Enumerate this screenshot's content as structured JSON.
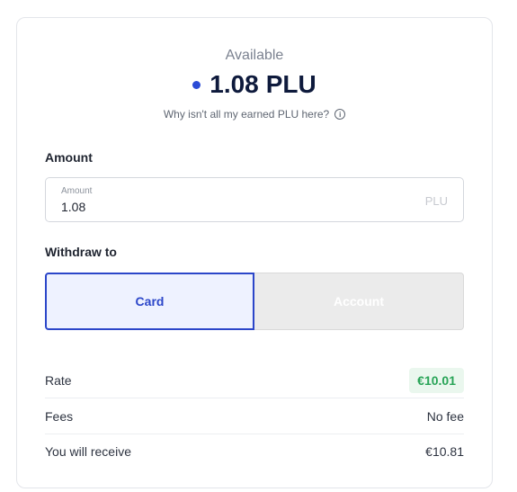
{
  "header": {
    "available_label": "Available",
    "balance_value": "1.08",
    "balance_unit": "PLU",
    "why_text": "Why isn't all my earned PLU here?",
    "info_icon": "info-circle-icon"
  },
  "amount": {
    "section_label": "Amount",
    "field_label": "Amount",
    "value": "1.08",
    "unit": "PLU"
  },
  "withdraw": {
    "section_label": "Withdraw to",
    "options": [
      {
        "label": "Card",
        "selected": true
      },
      {
        "label": "Account",
        "selected": false
      }
    ]
  },
  "summary": {
    "rate_label": "Rate",
    "rate_value": "€10.01",
    "fees_label": "Fees",
    "fees_value": "No fee",
    "receive_label": "You will receive",
    "receive_value": "€10.81"
  },
  "colors": {
    "accent": "#2b46c9",
    "rate_green": "#28a457",
    "rate_bg": "#eaf7ee"
  }
}
